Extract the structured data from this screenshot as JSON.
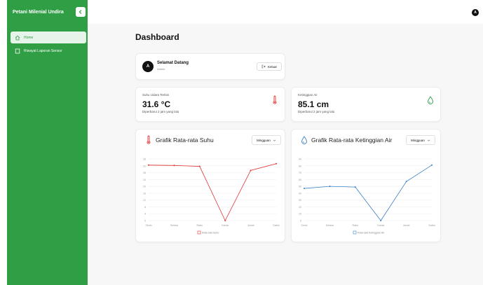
{
  "app": {
    "title": "Petani Milenial Undira"
  },
  "sidebar": {
    "items": [
      {
        "label": "Home",
        "icon": "home-icon",
        "active": true
      },
      {
        "label": "Riwayat Laporan Sensor",
        "icon": "document-icon",
        "active": false
      }
    ]
  },
  "user": {
    "initial": "A"
  },
  "page": {
    "title": "Dashboard"
  },
  "welcome": {
    "initial": "A",
    "title": "Selamat Datang",
    "subtitle": "Admin",
    "logout_label": "Keluar"
  },
  "stats": [
    {
      "label": "Suhu Udara Terkini",
      "value": "31.6 °C",
      "note": "Diperbarui 2 jam yang lalu",
      "icon": "thermometer-icon",
      "color": "#e03131"
    },
    {
      "label": "Ketinggian Air",
      "value": "85.1 cm",
      "note": "Diperbarui 2 jam yang lalu",
      "icon": "water-drop-icon",
      "color": "#2f9e44"
    }
  ],
  "charts": [
    {
      "title": "Grafik Rata-rata Suhu",
      "select": "Mingguan",
      "icon": "thermometer-icon"
    },
    {
      "title": "Grafik Rata-rata Ketinggian Air",
      "select": "Mingguan",
      "icon": "water-drop-icon"
    }
  ],
  "chart_data": [
    {
      "type": "line",
      "title": "Grafik Rata-rata Suhu",
      "categories": [
        "Senin",
        "Selasa",
        "Rabu",
        "Kamis",
        "Jumat",
        "Sabtu"
      ],
      "series": [
        {
          "name": "Rata-rata Suhu",
          "values": [
            31.5,
            31.3,
            30.8,
            0,
            28.5,
            32.3
          ],
          "color": "#e03131"
        }
      ],
      "y_ticks": [
        "35",
        "32",
        "28",
        "24",
        "20",
        "16",
        "12",
        "8",
        "4",
        "0"
      ],
      "ylim": [
        0,
        35
      ],
      "grid": true,
      "legend": "bottom"
    },
    {
      "type": "line",
      "title": "Grafik Rata-rata Ketinggian Air",
      "categories": [
        "Senin",
        "Selasa",
        "Rabu",
        "Kamis",
        "Jumat",
        "Sabtu"
      ],
      "series": [
        {
          "name": "Rata-rata Ketinggian Air",
          "values": [
            47,
            50,
            49,
            0,
            57,
            81
          ],
          "color": "#3b82c4"
        }
      ],
      "y_ticks": [
        "90",
        "80",
        "70",
        "60",
        "50",
        "40",
        "30",
        "20",
        "10",
        "0"
      ],
      "ylim": [
        0,
        90
      ],
      "grid": true,
      "legend": "bottom"
    }
  ]
}
